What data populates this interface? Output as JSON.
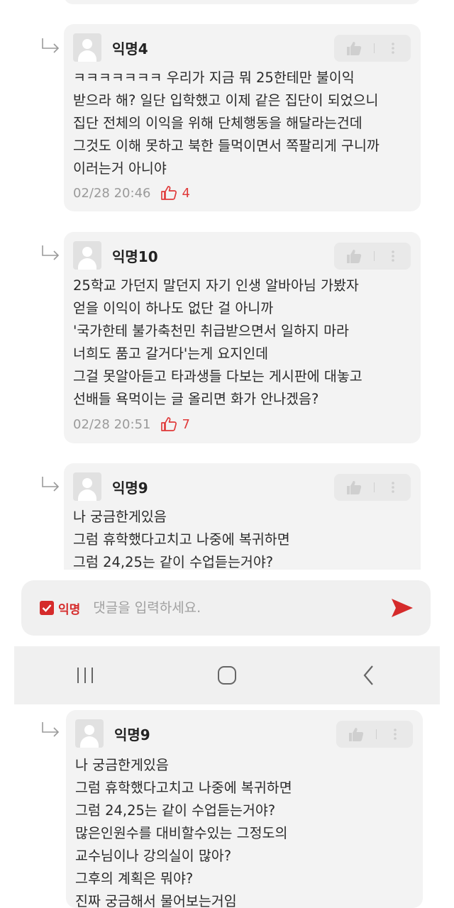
{
  "comments": [
    {
      "nickname": "익명4",
      "text": "ㅋㅋㅋㅋㅋㅋㅋ 우리가 지금 뭐 25한테만 불이익\n받으라 해? 일단 입학했고 이제 같은 집단이 되었으니\n집단 전체의 이익을 위해 단체행동을 해달라는건데\n그것도 이해 못하고 북한 들먹이면서 쪽팔리게 구니까\n이러는거 아니야",
      "timestamp": "02/28 20:46",
      "likes": "4"
    },
    {
      "nickname": "익명10",
      "text": "25학교 가던지 말던지 자기 인생 알바아님 가봤자\n얻을 이익이 하나도 없단 걸 아니까\n'국가한테 불가축천민 취급받으면서 일하지 마라\n너희도 품고 갈거다'는게 요지인데\n그걸 못알아듣고 타과생들 다보는 게시판에 대놓고\n선배들 욕먹이는 글 올리면 화가 안나겠음?",
      "timestamp": "02/28 20:51",
      "likes": "7"
    },
    {
      "nickname": "익명9",
      "text": "나 궁금한게있음\n그럼 휴학했다고치고 나중에 복귀하면\n그럼 24,25는 같이 수업듣는거야?"
    },
    {
      "nickname": "익명9",
      "text": "나 궁금한게있음\n그럼 휴학했다고치고 나중에 복귀하면\n그럼 24,25는 같이 수업듣는거야?\n많은인원수를 대비할수있는 그정도의\n교수님이나 강의실이 많아?\n그후의 계획은 뭐야?\n진짜 궁금해서 물어보는거임"
    }
  ],
  "input_bar": {
    "anonymous_label": "익명",
    "anonymous_checked": true,
    "placeholder": "댓글을 입력하세요.",
    "accent_color": "#d52b2b"
  },
  "nav_bar": {
    "buttons": [
      "recent-apps-icon",
      "home-icon",
      "back-icon"
    ]
  }
}
